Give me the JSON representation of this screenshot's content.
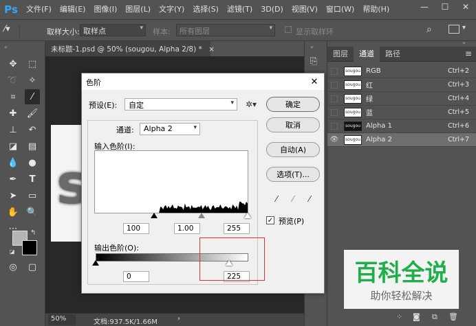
{
  "menubar": {
    "logo": "Ps",
    "items": [
      "文件(F)",
      "编辑(E)",
      "图像(I)",
      "图层(L)",
      "文字(Y)",
      "选择(S)",
      "滤镜(T)",
      "3D(D)",
      "视图(V)",
      "窗口(W)",
      "帮助(H)"
    ],
    "win_controls": [
      "—",
      "☐",
      "✕"
    ]
  },
  "options": {
    "sample_size_label": "取样大小:",
    "sample_size_value": "取样点",
    "sample_label": "样本:",
    "sample_value": "所有图层",
    "show_ring_label": "显示取样环"
  },
  "document": {
    "tab_title": "未标题-1.psd @ 50% (sougou, Alpha 2/8) *",
    "tab_close": "×",
    "canvas_letter": "s",
    "zoom": "50%",
    "doc_info": "文档:937.5K/1.66M"
  },
  "panel": {
    "tabs": [
      "图层",
      "通道",
      "路径"
    ],
    "active_tab": 1,
    "channels": [
      {
        "thumb": "sougou",
        "name": "RGB",
        "key": "Ctrl+2",
        "dark": false,
        "selected": false
      },
      {
        "thumb": "sougou",
        "name": "红",
        "key": "Ctrl+3",
        "dark": false,
        "selected": false
      },
      {
        "thumb": "sougou",
        "name": "绿",
        "key": "Ctrl+4",
        "dark": false,
        "selected": false
      },
      {
        "thumb": "sougou",
        "name": "蓝",
        "key": "Ctrl+5",
        "dark": false,
        "selected": false
      },
      {
        "thumb": "sougou",
        "name": "Alpha 1",
        "key": "Ctrl+6",
        "dark": true,
        "selected": false
      },
      {
        "thumb": "sougou",
        "name": "Alpha 2",
        "key": "Ctrl+7",
        "dark": false,
        "selected": true
      }
    ]
  },
  "dialog": {
    "title": "色阶",
    "preset_label": "预设(E):",
    "preset_value": "自定",
    "channel_label": "通道:",
    "channel_value": "Alpha 2",
    "input_label": "输入色阶(I):",
    "input_black": "100",
    "input_gamma": "1.00",
    "input_white": "255",
    "output_label": "输出色阶(O):",
    "output_black": "0",
    "output_white": "225",
    "ok_label": "确定",
    "cancel_label": "取消",
    "auto_label": "自动(A)",
    "options_label": "选项(T)...",
    "preview_label": "预览(P)",
    "preview_checked": true,
    "close_glyph": "✕"
  },
  "watermark": {
    "big": "百科全说",
    "small": "助你轻松解决"
  }
}
